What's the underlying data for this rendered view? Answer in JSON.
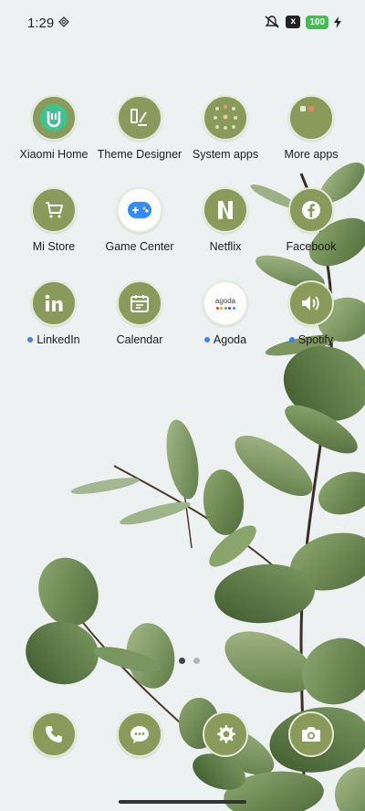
{
  "status_bar": {
    "time": "1:29",
    "battery": "100",
    "sim_icon": "x"
  },
  "apps": [
    {
      "label": "Xiaomi Home",
      "icon": "xiaomi-home-icon",
      "new": false
    },
    {
      "label": "Theme Designer",
      "icon": "theme-designer-icon",
      "new": false
    },
    {
      "label": "System apps",
      "icon": "folder-icon",
      "new": false
    },
    {
      "label": "More apps",
      "icon": "folder-icon",
      "new": false
    },
    {
      "label": "Mi Store",
      "icon": "cart-icon",
      "new": false
    },
    {
      "label": "Game Center",
      "icon": "gamepad-icon",
      "new": false
    },
    {
      "label": "Netflix",
      "icon": "netflix-icon",
      "new": false
    },
    {
      "label": "Facebook",
      "icon": "facebook-icon",
      "new": false
    },
    {
      "label": "LinkedIn",
      "icon": "linkedin-icon",
      "new": true
    },
    {
      "label": "Calendar",
      "icon": "calendar-icon",
      "new": false
    },
    {
      "label": "Agoda",
      "icon": "agoda-icon",
      "new": true
    },
    {
      "label": "Spotify",
      "icon": "speaker-icon",
      "new": true
    }
  ],
  "agoda_logo_text": "agoda",
  "pages": {
    "count": 2,
    "active": 0
  },
  "dock": [
    {
      "name": "phone-icon"
    },
    {
      "name": "messages-icon"
    },
    {
      "name": "settings-icon"
    },
    {
      "name": "camera-icon"
    }
  ],
  "colors": {
    "icon_bg": "#8a9a5a",
    "background": "#eef1f2",
    "notification_dot": "#3b82f6",
    "battery": "#3cc44a"
  }
}
